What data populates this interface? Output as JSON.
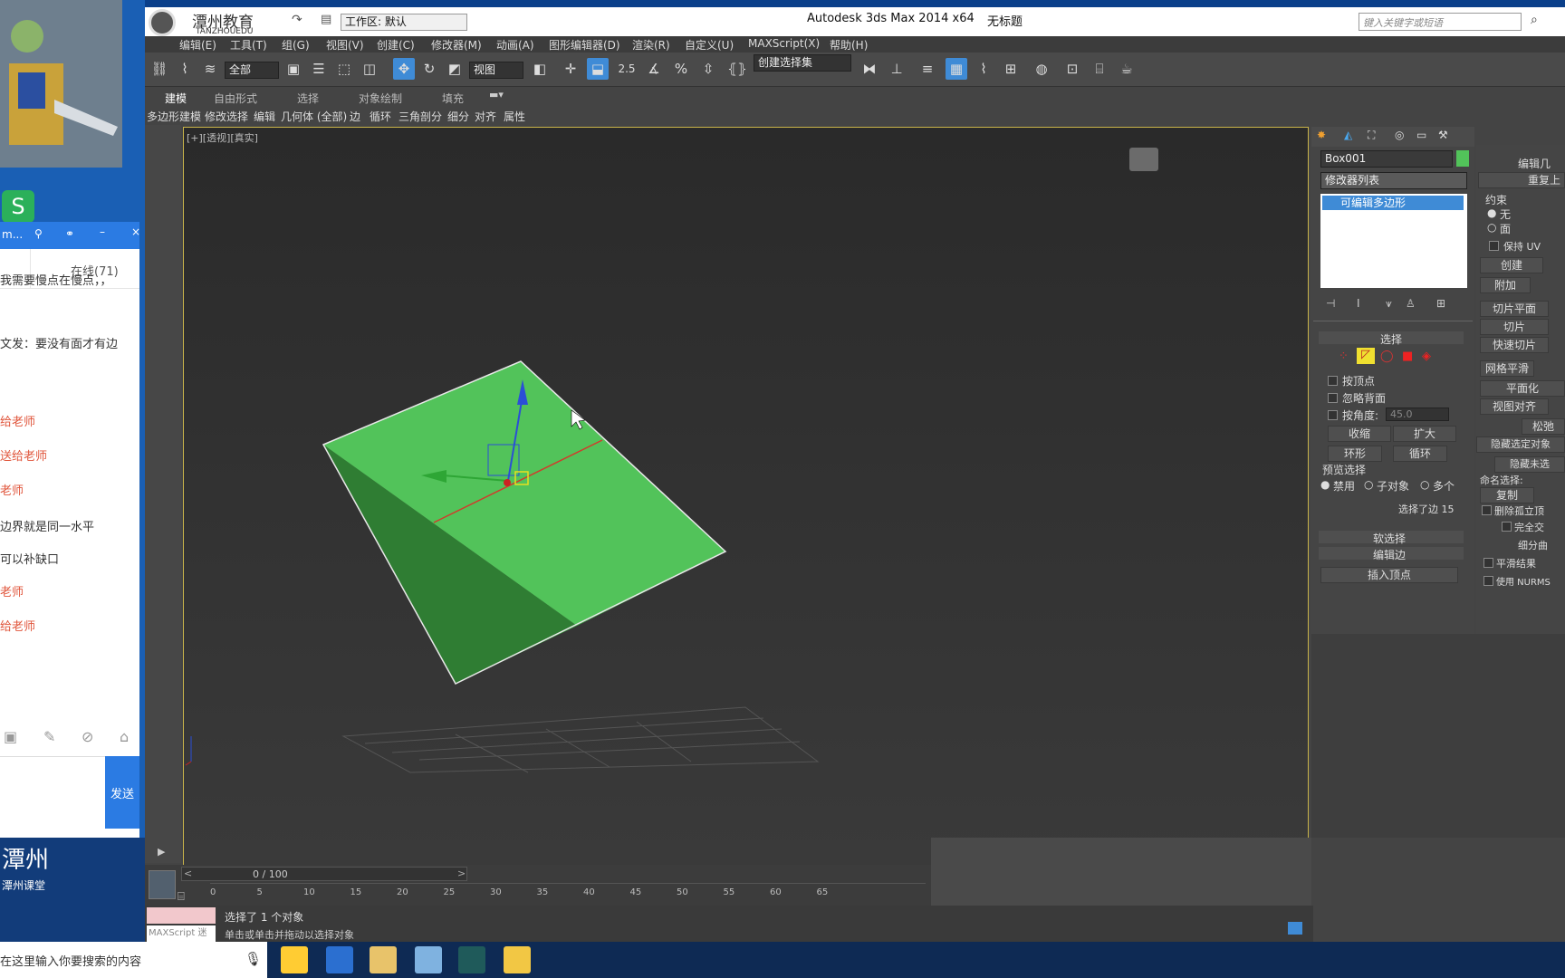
{
  "chat": {
    "tab_online": "在线(71)",
    "window_label": "m...",
    "messages": [
      {
        "text": "我需要慢点在慢点，，",
        "red": false
      },
      {
        "text": "文发：要没有面才有边",
        "red": false
      },
      {
        "text": "给老师",
        "red": true
      },
      {
        "text": "送给老师",
        "red": true
      },
      {
        "text": "老师",
        "red": true
      },
      {
        "text": "边界就是同一水平",
        "red": false
      },
      {
        "text": "可以补缺口",
        "red": false
      },
      {
        "text": "老师",
        "red": true
      },
      {
        "text": "给老师",
        "red": true
      }
    ],
    "send_label": "发送",
    "brand": "潭州",
    "brand_sub": "潭州课堂"
  },
  "titlebar": {
    "logo_text": "潭州教育",
    "logo_sub": "TANZHOUEDU",
    "workspace_label": "工作区: 默认",
    "app_title": "Autodesk 3ds Max  2014 x64",
    "doc_title": "无标题",
    "search_placeholder": "键入关键字或短语"
  },
  "menu": [
    "编辑(E)",
    "工具(T)",
    "组(G)",
    "视图(V)",
    "创建(C)",
    "修改器(M)",
    "动画(A)",
    "图形编辑器(D)",
    "渲染(R)",
    "自定义(U)",
    "MAXScript(X)",
    "帮助(H)"
  ],
  "toolbar": {
    "filter_value": "全部",
    "ref_coord_value": "视图",
    "snap_value": "2.5",
    "named_sel_placeholder": "创建选择集"
  },
  "ribbon": {
    "tabs": [
      "建模",
      "自由形式",
      "选择",
      "对象绘制",
      "填充"
    ],
    "subtools": [
      "多边形建模",
      "修改选择",
      "编辑",
      "几何体 (全部)",
      "边",
      "循环",
      "三角剖分",
      "细分",
      "对齐",
      "属性"
    ]
  },
  "viewport": {
    "label": "[+][透视][真实]"
  },
  "command_panel": {
    "object_name": "Box001",
    "modifier_list": "修改器列表",
    "stack_item": "可编辑多边形",
    "selection_title": "选择",
    "by_vertex": "按顶点",
    "ignore_backface": "忽略背面",
    "by_angle": "按角度:",
    "angle_value": "45.0",
    "shrink": "收缩",
    "grow": "扩大",
    "ring": "环形",
    "loop": "循环",
    "preview_title": "预览选择",
    "preview_off": "禁用",
    "preview_sub": "子对象",
    "preview_multi": "多个",
    "selected_info": "选择了边 15",
    "soft_sel": "软选择",
    "edit_edges": "编辑边",
    "insert_vertex": "插入顶点"
  },
  "right_panel": {
    "title": "编辑几",
    "repeat": "重复上",
    "constraint": "约束",
    "none": "无",
    "face": "面",
    "keep_uv": "保持 UV",
    "create": "创建",
    "attach": "附加",
    "slice_plane": "切片平面",
    "slice": "切片",
    "quick_slice": "快速切片",
    "mesh_smooth": "网格平滑",
    "planarize": "平面化",
    "view_align": "视图对齐",
    "relax": "松弛",
    "hide_sel": "隐藏选定对象",
    "hide_unsel": "隐藏未选",
    "named_sel": "命名选择:",
    "copy": "复制",
    "del_isolated": "删除孤立顶",
    "full_inter": "完全交",
    "subdiv": "细分曲",
    "smooth_result": "平滑结果",
    "use_nurms": "使用 NURMS"
  },
  "timeline": {
    "frame": "0 / 100",
    "ticks": [
      "0",
      "5",
      "10",
      "15",
      "20",
      "25",
      "30",
      "35",
      "40",
      "45",
      "50",
      "55",
      "60",
      "65"
    ]
  },
  "status": {
    "selected": "选择了 1 个对象",
    "hint": "单击或单击并拖动以选择对象",
    "maxscript": "MAXScript 迷"
  },
  "taskbar": {
    "search_text": "在这里输入你要搜索的内容"
  },
  "colors": {
    "box_top": "#52c35a",
    "box_side": "#2f7d33",
    "viewport_border": "#c9b44a",
    "accent": "#3f8bd6"
  }
}
